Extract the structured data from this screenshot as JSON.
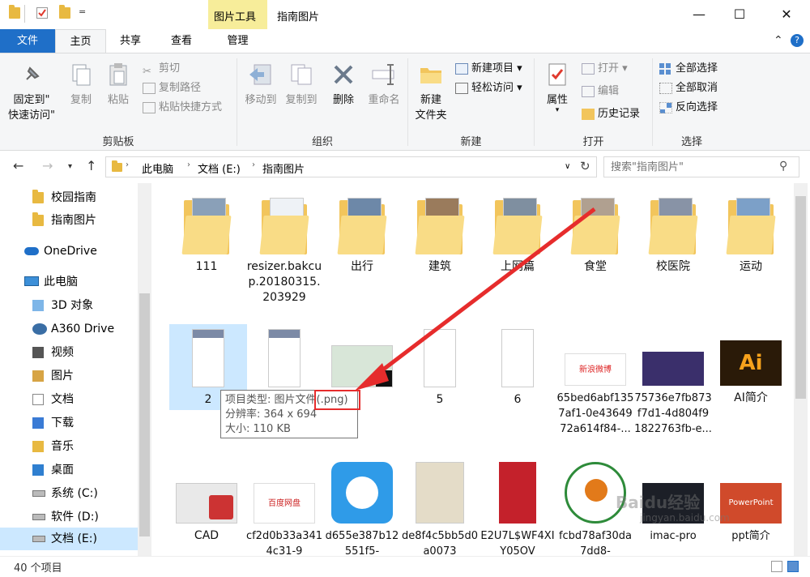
{
  "titlebar": {
    "context_tool": "图片工具",
    "title": "指南图片",
    "qa_dropdown": "=",
    "minimize": "—",
    "maximize": "☐",
    "close": "✕"
  },
  "tabs": {
    "file": "文件",
    "home": "主页",
    "share": "共享",
    "view": "查看",
    "manage": "管理",
    "chevron": "⌃",
    "help": "?"
  },
  "ribbon": {
    "clipboard": {
      "label": "剪贴板",
      "pin_line1": "固定到\"",
      "pin_line2": "快速访问\"",
      "copy": "复制",
      "paste": "粘贴",
      "cut": "剪切",
      "copy_path": "复制路径",
      "paste_shortcut": "粘贴快捷方式"
    },
    "organize": {
      "label": "组织",
      "move_to": "移动到",
      "copy_to": "复制到",
      "delete": "删除",
      "rename": "重命名"
    },
    "new": {
      "label": "新建",
      "new_folder_line1": "新建",
      "new_folder_line2": "文件夹",
      "new_item": "新建项目",
      "easy_access": "轻松访问"
    },
    "open": {
      "label": "打开",
      "properties": "属性",
      "open": "打开",
      "edit": "编辑",
      "history": "历史记录"
    },
    "select": {
      "label": "选择",
      "select_all": "全部选择",
      "select_none": "全部取消",
      "invert": "反向选择"
    }
  },
  "address": {
    "crumbs": [
      "此电脑",
      "文档 (E:)",
      "指南图片"
    ],
    "search_placeholder": "搜索\"指南图片\""
  },
  "sidebar": {
    "items": [
      {
        "label": "校园指南",
        "icon": "folder-icon"
      },
      {
        "label": "指南图片",
        "icon": "folder-icon"
      },
      {
        "label": "OneDrive",
        "icon": "cloud-icon"
      },
      {
        "label": "此电脑",
        "icon": "computer-icon"
      },
      {
        "label": "3D 对象",
        "icon": "3d-objects-icon"
      },
      {
        "label": "A360 Drive",
        "icon": "a360-icon"
      },
      {
        "label": "视频",
        "icon": "video-icon"
      },
      {
        "label": "图片",
        "icon": "pictures-icon"
      },
      {
        "label": "文档",
        "icon": "documents-icon"
      },
      {
        "label": "下载",
        "icon": "download-icon"
      },
      {
        "label": "音乐",
        "icon": "music-icon"
      },
      {
        "label": "桌面",
        "icon": "desktop-icon"
      },
      {
        "label": "系统 (C:)",
        "icon": "drive-c-icon"
      },
      {
        "label": "软件 (D:)",
        "icon": "drive-d-icon"
      },
      {
        "label": "文档 (E:)",
        "icon": "drive-e-icon"
      }
    ]
  },
  "files": {
    "row1": [
      "111",
      "resizer.bakcup.20180315.203929",
      "出行",
      "建筑",
      "上网篇",
      "食堂",
      "校医院",
      "运动"
    ],
    "row2": [
      "2",
      "",
      "",
      "5",
      "6",
      "65bed6abf1357af1-0e4364972a614f84-...",
      "75736e7fb873f7d1-4d804f91822763fb-e...",
      "AI简介"
    ],
    "row3": [
      "CAD",
      "cf2d0b33a3414c31-9",
      "d655e387b12551f5-",
      "de8f4c5bb5d0a0073",
      "E2U7L$WF4XIY05OV",
      "fcbd78af30da7dd8-",
      "imac-pro",
      "ppt简介"
    ]
  },
  "tooltip": {
    "type_line": "项目类型: 图片文件(.png)",
    "res_line": "分辨率: 364 x 694",
    "size_line": "大小: 110 KB"
  },
  "status": {
    "count": "40 个项目"
  },
  "thumb_texts": {
    "weibo": "新浪微博",
    "ai": "Ai",
    "ppt": "PowerPoint",
    "baidu": "百度网盘"
  },
  "watermark": {
    "line1": "Baidu经验",
    "line2": "jingyan.baidu.com"
  },
  "colors": {
    "accent": "#1f6fc8",
    "context_tab": "#f7ed9a",
    "highlight_red": "#e62c2c",
    "selected_tile": "#cce8ff"
  }
}
